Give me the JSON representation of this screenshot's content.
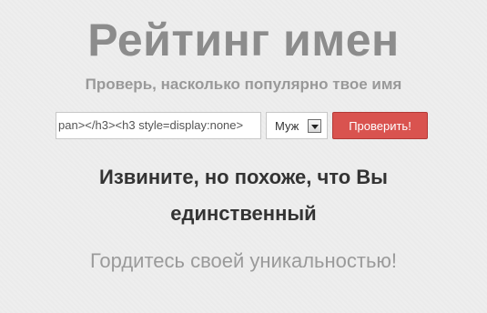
{
  "header": {
    "title": "Рейтинг имен",
    "subtitle": "Проверь, насколько популярно твое имя"
  },
  "form": {
    "name_value": "pan></h3><h3 style=display:none>",
    "gender_selected": "Муж",
    "submit_label": "Проверить!"
  },
  "result": {
    "heading": "Извините, но похоже, что Вы единственный",
    "subheading": "Гордитесь своей уникальностью!"
  },
  "colors": {
    "button": "#d9534f",
    "title": "#8c8c8c",
    "background": "#eeeeee"
  }
}
